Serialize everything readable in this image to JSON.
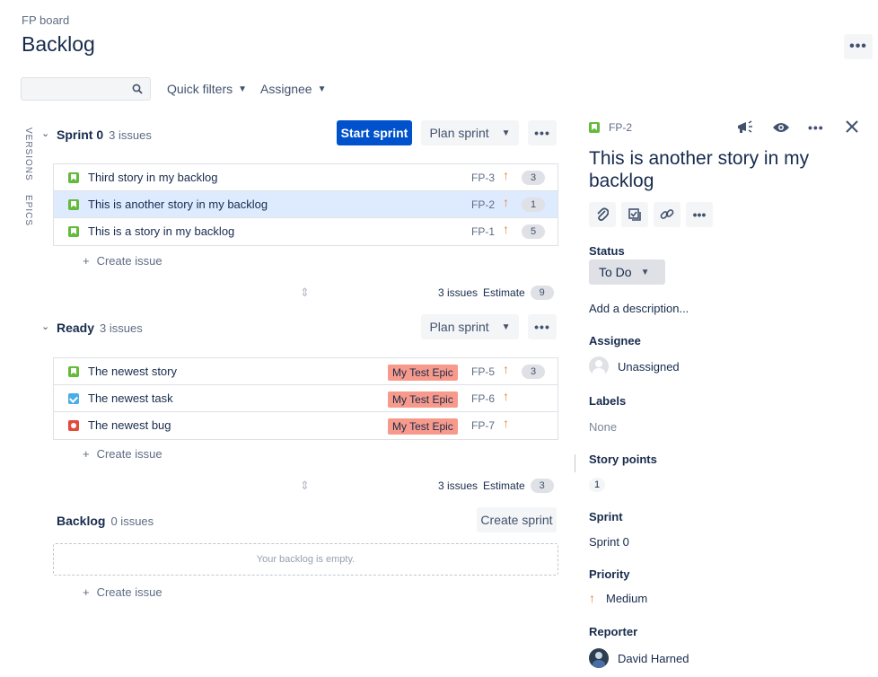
{
  "breadcrumb": "FP board",
  "page_title": "Backlog",
  "toolbar": {
    "search_placeholder": "",
    "quick_filters": "Quick filters",
    "assignee": "Assignee"
  },
  "side_tabs": {
    "versions": "VERSIONS",
    "epics": "EPICS"
  },
  "sprint0": {
    "name": "Sprint 0",
    "count": "3 issues",
    "start_label": "Start sprint",
    "plan_label": "Plan sprint",
    "issues": [
      {
        "type": "story",
        "summary": "Third story in my backlog",
        "key": "FP-3",
        "estimate": "3"
      },
      {
        "type": "story",
        "summary": "This is another story in my backlog",
        "key": "FP-2",
        "estimate": "1"
      },
      {
        "type": "story",
        "summary": "This is a story in my backlog",
        "key": "FP-1",
        "estimate": "5"
      }
    ],
    "create_label": "Create issue",
    "footer_count": "3 issues",
    "footer_estimate_label": "Estimate",
    "footer_estimate": "9"
  },
  "ready": {
    "name": "Ready",
    "count": "3 issues",
    "plan_label": "Plan sprint",
    "issues": [
      {
        "type": "story",
        "summary": "The newest story",
        "epic": "My Test Epic",
        "key": "FP-5",
        "estimate": "3"
      },
      {
        "type": "task",
        "summary": "The newest task",
        "epic": "My Test Epic",
        "key": "FP-6",
        "estimate": ""
      },
      {
        "type": "bug",
        "summary": "The newest bug",
        "epic": "My Test Epic",
        "key": "FP-7",
        "estimate": ""
      }
    ],
    "create_label": "Create issue",
    "footer_count": "3 issues",
    "footer_estimate_label": "Estimate",
    "footer_estimate": "3"
  },
  "backlog": {
    "name": "Backlog",
    "count": "0 issues",
    "create_sprint_label": "Create sprint",
    "empty_text": "Your backlog is empty.",
    "create_label": "Create issue"
  },
  "detail": {
    "key": "FP-2",
    "title": "This is another story in my backlog",
    "status_label": "Status",
    "status_value": "To Do",
    "description_placeholder": "Add a description...",
    "assignee_label": "Assignee",
    "assignee_value": "Unassigned",
    "labels_label": "Labels",
    "labels_value": "None",
    "story_points_label": "Story points",
    "story_points_value": "1",
    "sprint_label": "Sprint",
    "sprint_value": "Sprint 0",
    "priority_label": "Priority",
    "priority_value": "Medium",
    "reporter_label": "Reporter",
    "reporter_value": "David Harned"
  },
  "colors": {
    "primary": "#0052cc",
    "story": "#63ba3c",
    "task": "#4bade8",
    "bug": "#e5493a",
    "epic": "#f79a8b",
    "priority_medium": "#e97f33",
    "selected_row": "#deebff"
  }
}
